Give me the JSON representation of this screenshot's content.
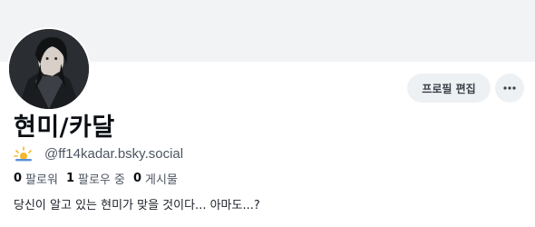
{
  "profile": {
    "display_name": "현미/카달",
    "handle": "@ff14kadar.bsky.social",
    "bio": "당신이 알고 있는 현미가 맞을 것이다... 아마도...?",
    "avatar_icon": "profile-avatar-image",
    "handle_badge_icon": "sun-cloud-icon"
  },
  "actions": {
    "edit_profile_label": "프로필 편집",
    "more_icon": "ellipsis-icon"
  },
  "stats": {
    "followers": {
      "count": "0",
      "label": "팔로워"
    },
    "following": {
      "count": "1",
      "label": "팔로우 중"
    },
    "posts": {
      "count": "0",
      "label": "게시물"
    }
  },
  "colors": {
    "banner": "#f1f3f5",
    "button_bg": "#eef1f4",
    "text_primary": "#0b0f14",
    "text_secondary": "#4d5662",
    "sun": "#f2b82c",
    "cloud": "#5b8fd9"
  }
}
